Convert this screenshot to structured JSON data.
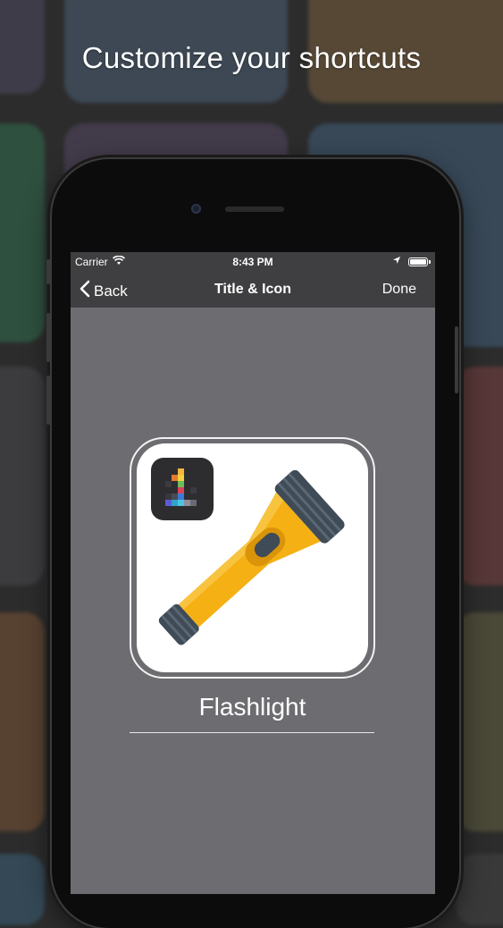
{
  "headline": "Customize your shortcuts",
  "status_bar": {
    "carrier": "Carrier",
    "time": "8:43 PM"
  },
  "nav": {
    "back_label": "Back",
    "title": "Title & Icon",
    "done_label": "Done"
  },
  "shortcut": {
    "name": "Flashlight",
    "icon": "flashlight-icon",
    "app_badge_icon": "launcher-app-icon"
  },
  "colors": {
    "screen_background": "#6d6c70",
    "bar_background": "#3f3f41",
    "flashlight_body": "#f5b014",
    "flashlight_dark": "#3f4b57"
  }
}
